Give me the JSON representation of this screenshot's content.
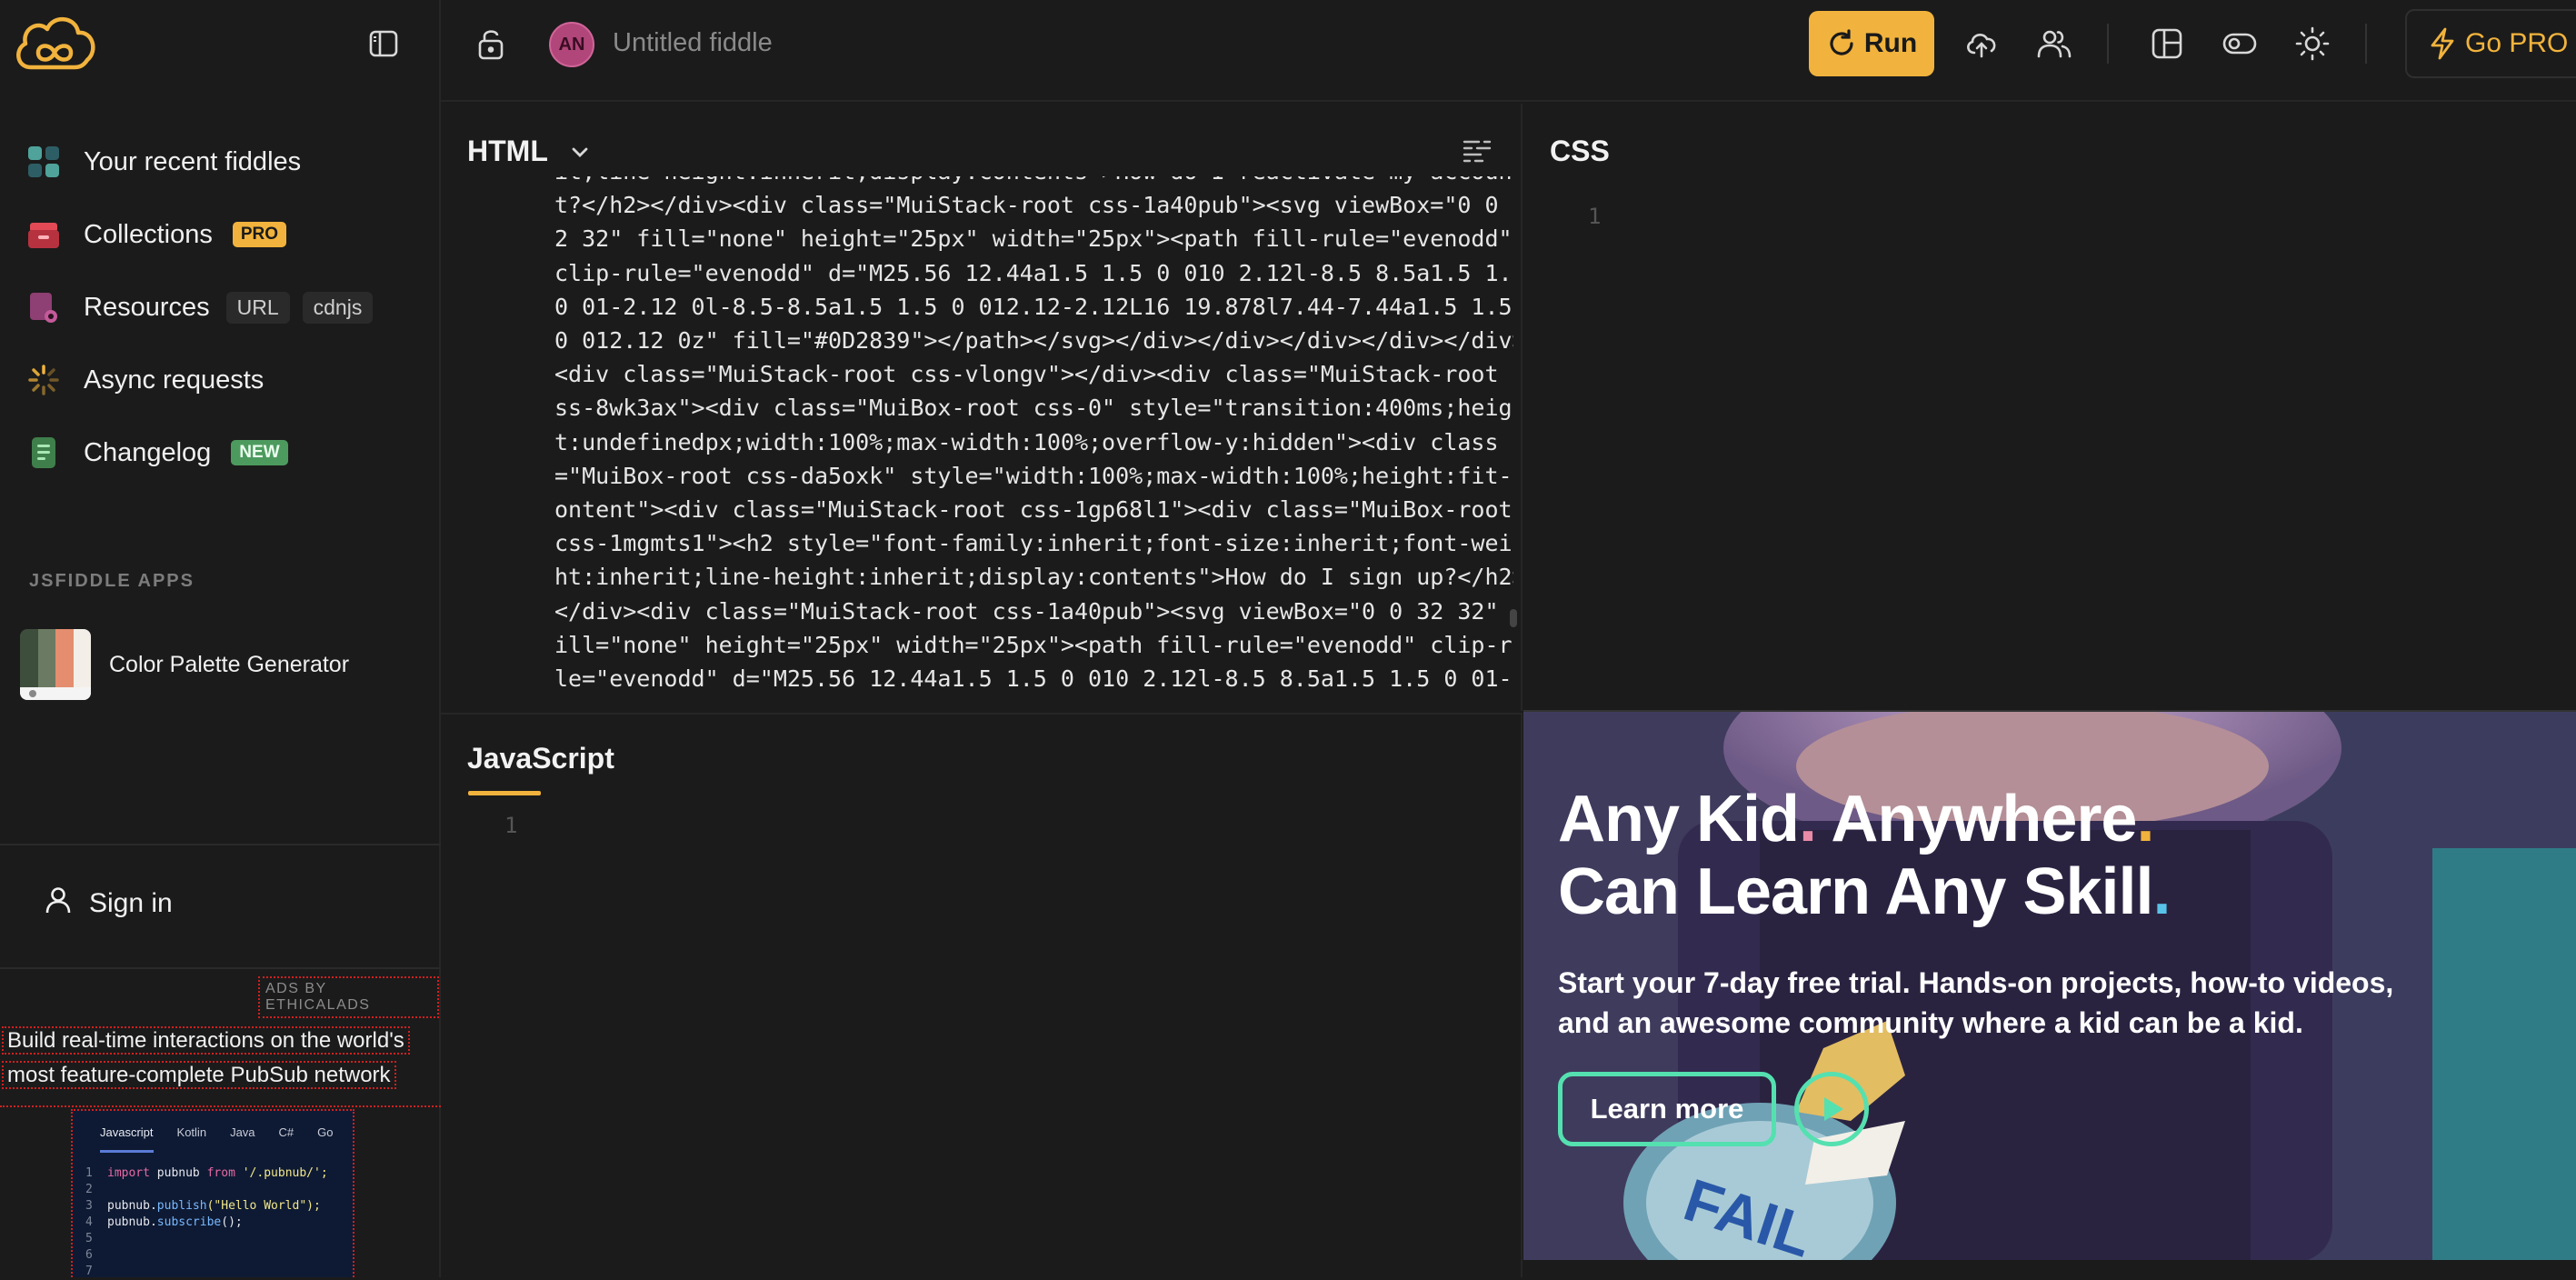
{
  "app": {
    "title": "Untitled fiddle",
    "avatar_initials": "AN",
    "accent": "#f1b33d"
  },
  "toolbar": {
    "run_label": "Run",
    "gopro_label": "Go PRO"
  },
  "sidebar": {
    "items": [
      {
        "label": "Your recent fiddles"
      },
      {
        "label": "Collections",
        "badge": "PRO"
      },
      {
        "label": "Resources",
        "chips": [
          "URL",
          "cdnjs"
        ]
      },
      {
        "label": "Async requests"
      },
      {
        "label": "Changelog",
        "badge": "NEW"
      }
    ],
    "apps_heading": "JSFIDDLE APPS",
    "apps": [
      {
        "label": "Color Palette Generator"
      }
    ],
    "signin_label": "Sign in"
  },
  "sidebar_ad": {
    "ads_by": "ADS BY ETHICALADS",
    "line1": "Build real-time interactions on the world's",
    "line2": "most feature-complete PubSub network",
    "tabs": [
      "Javascript",
      "Kotlin",
      "Java",
      "C#",
      "Go"
    ],
    "code": {
      "l1_import": "import",
      "l1_name": " pubnub ",
      "l1_from": "from",
      "l1_path": " '/.pubnub/';",
      "l3_obj": "pubnub.",
      "l3_fn": "publish",
      "l3_arg": "(\"Hello World\");",
      "l4_obj": "pubnub.",
      "l4_fn": "subscribe",
      "l4_arg": "();"
    }
  },
  "panels": {
    "html_title": "HTML",
    "css_title": "CSS",
    "js_title": "JavaScript",
    "line_one": "1",
    "html_lines": [
      "it;line-height:inherit;display:contents\">How do I reactivate my accoun",
      "t?</h2></div><div class=\"MuiStack-root css-1a40pub\"><svg viewBox=\"0 0 3",
      "2 32\" fill=\"none\" height=\"25px\" width=\"25px\"><path fill-rule=\"evenodd\"",
      "clip-rule=\"evenodd\" d=\"M25.56 12.44a1.5 1.5 0 010 2.12l-8.5 8.5a1.5 1.5",
      "0 01-2.12 0l-8.5-8.5a1.5 1.5 0 012.12-2.12L16 19.878l7.44-7.44a1.5 1.5",
      "0 012.12 0z\" fill=\"#0D2839\"></path></svg></div></div></div></div></div>",
      "<div class=\"MuiStack-root css-vlongv\"></div><div class=\"MuiStack-root c",
      "ss-8wk3ax\"><div class=\"MuiBox-root css-0\" style=\"transition:400ms;heigh",
      "t:undefinedpx;width:100%;max-width:100%;overflow-y:hidden\"><div class",
      "=\"MuiBox-root css-da5oxk\" style=\"width:100%;max-width:100%;height:fit-c",
      "ontent\"><div class=\"MuiStack-root css-1gp68l1\"><div class=\"MuiBox-root",
      "css-1mgmts1\"><h2 style=\"font-family:inherit;font-size:inherit;font-weig",
      "ht:inherit;line-height:inherit;display:contents\">How do I sign up?</h2>",
      "</div><div class=\"MuiStack-root css-1a40pub\"><svg viewBox=\"0 0 32 32\" f",
      "ill=\"none\" height=\"25px\" width=\"25px\"><path fill-rule=\"evenodd\" clip-ru",
      "le=\"evenodd\" d=\"M25.56 12.44a1.5 1.5 0 010 2.12l-8.5 8.5a1.5 1.5 0 01-"
    ]
  },
  "video_ad": {
    "headline_1a": "Any Kid",
    "headline_1b": " Anywhere",
    "headline_2": "Can Learn Any Skill",
    "dot": ".",
    "sub": "Start your 7-day free trial. Hands-on projects, how-to videos, and an awesome community where a kid can be a kid.",
    "cta": "Learn more"
  }
}
